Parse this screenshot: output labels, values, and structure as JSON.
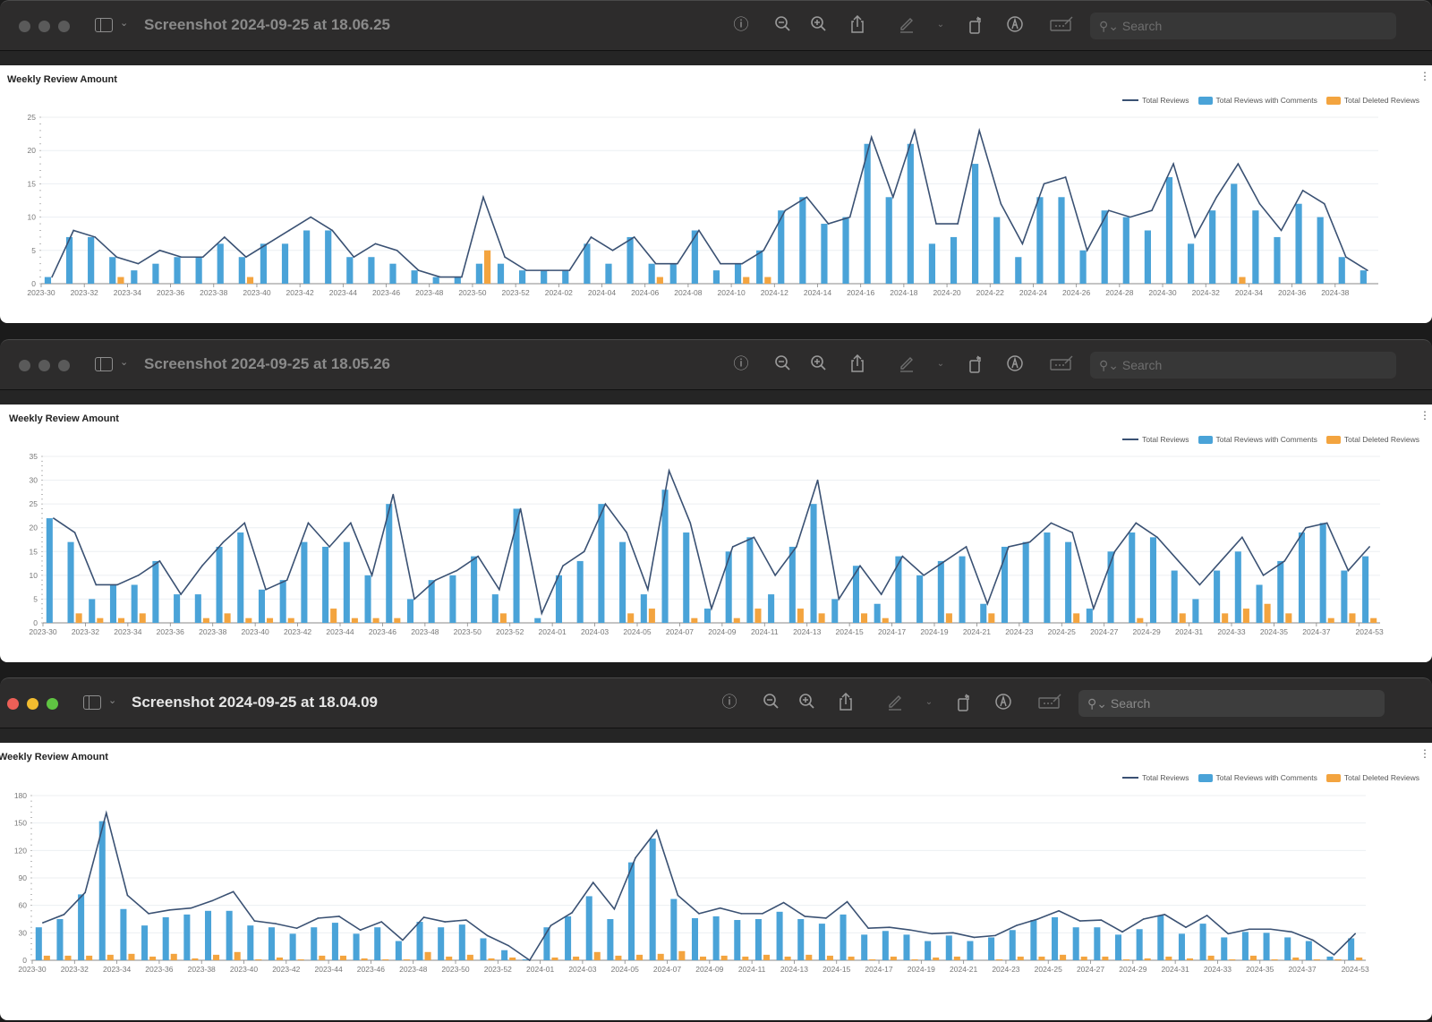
{
  "windows": [
    {
      "title": "Screenshot 2024-09-25 at 18.06.25",
      "active": false,
      "search_placeholder": "Search",
      "toolbar": [
        "info-icon",
        "zoom-out-icon",
        "zoom-in-icon",
        "share-icon",
        "markup-pen-icon",
        "chevron-down-icon",
        "rotate-icon",
        "annotate-icon",
        "signature-icon"
      ]
    },
    {
      "title": "Screenshot 2024-09-25 at 18.05.26",
      "active": false,
      "search_placeholder": "Search",
      "toolbar": [
        "info-icon",
        "zoom-out-icon",
        "zoom-in-icon",
        "share-icon",
        "markup-pen-icon",
        "chevron-down-icon",
        "rotate-icon",
        "annotate-icon",
        "signature-icon"
      ]
    },
    {
      "title": "Screenshot 2024-09-25 at 18.04.09",
      "active": true,
      "search_placeholder": "Search",
      "toolbar": [
        "info-icon",
        "zoom-out-icon",
        "zoom-in-icon",
        "share-icon",
        "markup-pen-icon",
        "chevron-down-icon",
        "rotate-icon",
        "annotate-icon",
        "signature-icon"
      ]
    }
  ],
  "legend": {
    "total": "Total Reviews",
    "comments": "Total Reviews with Comments",
    "deleted": "Total Deleted Reviews"
  },
  "colors": {
    "total_line": "#3a5173",
    "comments_bar": "#4aa3d8",
    "deleted_bar": "#f3a43f"
  },
  "chart_data": [
    {
      "type": "bar",
      "title": "Weekly Review Amount",
      "ylim": [
        0,
        25
      ],
      "yticks": [
        0,
        5,
        10,
        15,
        20,
        25
      ],
      "legend_position": "top-right",
      "grid": true,
      "tick_labels": [
        "2023-30",
        "2023-32",
        "2023-34",
        "2023-36",
        "2023-38",
        "2023-40",
        "2023-42",
        "2023-44",
        "2023-46",
        "2023-48",
        "2023-50",
        "2023-52",
        "2024-02",
        "2024-04",
        "2024-06",
        "2024-08",
        "2024-10",
        "2024-12",
        "2024-14",
        "2024-16",
        "2024-18",
        "2024-20",
        "2024-22",
        "2024-24",
        "2024-26",
        "2024-28",
        "2024-30",
        "2024-32",
        "2024-34",
        "2024-36",
        "2024-38"
      ],
      "series": [
        {
          "name": "Total Reviews",
          "kind": "line",
          "values": [
            1,
            8,
            7,
            4,
            3,
            5,
            4,
            4,
            7,
            4,
            6,
            8,
            10,
            8,
            4,
            6,
            5,
            2,
            1,
            1,
            13,
            4,
            2,
            2,
            2,
            7,
            5,
            7,
            3,
            3,
            8,
            3,
            3,
            5,
            11,
            13,
            9,
            10,
            22,
            13,
            23,
            9,
            9,
            23,
            12,
            6,
            15,
            16,
            5,
            11,
            10,
            11,
            18,
            7,
            13,
            18,
            12,
            8,
            14,
            12,
            4,
            2
          ]
        },
        {
          "name": "Total Reviews with Comments",
          "kind": "bar",
          "values": [
            1,
            7,
            7,
            4,
            2,
            3,
            4,
            4,
            6,
            4,
            6,
            6,
            8,
            8,
            4,
            4,
            3,
            2,
            1,
            1,
            3,
            3,
            2,
            2,
            2,
            6,
            3,
            7,
            3,
            3,
            8,
            2,
            3,
            5,
            11,
            13,
            9,
            10,
            21,
            13,
            21,
            6,
            7,
            18,
            10,
            4,
            13,
            13,
            5,
            11,
            10,
            8,
            16,
            6,
            11,
            15,
            11,
            7,
            12,
            10,
            4,
            2
          ]
        },
        {
          "name": "Total Deleted Reviews",
          "kind": "bar",
          "values": [
            0,
            0,
            0,
            1,
            0,
            0,
            0,
            0,
            0,
            1,
            0,
            0,
            0,
            0,
            0,
            0,
            0,
            0,
            0,
            0,
            5,
            0,
            0,
            0,
            0,
            0,
            0,
            0,
            1,
            0,
            0,
            0,
            1,
            1,
            0,
            0,
            0,
            0,
            0,
            0,
            0,
            0,
            0,
            0,
            0,
            0,
            0,
            0,
            0,
            0,
            0,
            0,
            0,
            0,
            0,
            1,
            0,
            0,
            0,
            0,
            0,
            0
          ]
        }
      ]
    },
    {
      "type": "bar",
      "title": "Weekly Review Amount",
      "ylim": [
        0,
        35
      ],
      "yticks": [
        0,
        5,
        10,
        15,
        20,
        25,
        30,
        35
      ],
      "legend_position": "top-right",
      "grid": true,
      "tick_labels": [
        "2023-30",
        "2023-32",
        "2023-34",
        "2023-36",
        "2023-38",
        "2023-40",
        "2023-42",
        "2023-44",
        "2023-46",
        "2023-48",
        "2023-50",
        "2023-52",
        "2024-01",
        "2024-03",
        "2024-05",
        "2024-07",
        "2024-09",
        "2024-11",
        "2024-13",
        "2024-15",
        "2024-17",
        "2024-19",
        "2024-21",
        "2024-23",
        "2024-25",
        "2024-27",
        "2024-29",
        "2024-31",
        "2024-33",
        "2024-35",
        "2024-37",
        "2024-53"
      ],
      "series": [
        {
          "name": "Total Reviews",
          "kind": "line",
          "values": [
            22,
            19,
            8,
            8,
            10,
            13,
            6,
            12,
            17,
            21,
            7,
            9,
            21,
            16,
            21,
            10,
            27,
            5,
            9,
            11,
            14,
            7,
            24,
            2,
            12,
            15,
            25,
            19,
            7,
            32,
            21,
            3,
            16,
            18,
            10,
            16,
            30,
            5,
            12,
            6,
            14,
            10,
            13,
            16,
            4,
            16,
            17,
            21,
            19,
            3,
            15,
            21,
            18,
            13,
            8,
            13,
            18,
            10,
            13,
            20,
            21,
            11,
            16
          ]
        },
        {
          "name": "Total Reviews with Comments",
          "kind": "bar",
          "values": [
            22,
            17,
            5,
            8,
            8,
            13,
            6,
            6,
            16,
            19,
            7,
            9,
            17,
            16,
            17,
            10,
            25,
            5,
            9,
            10,
            14,
            6,
            24,
            1,
            10,
            13,
            25,
            17,
            6,
            28,
            19,
            3,
            15,
            18,
            6,
            16,
            25,
            5,
            12,
            4,
            14,
            10,
            13,
            14,
            4,
            16,
            17,
            19,
            17,
            3,
            15,
            19,
            18,
            11,
            5,
            11,
            15,
            8,
            13,
            19,
            21,
            11,
            14
          ]
        },
        {
          "name": "Total Deleted Reviews",
          "kind": "bar",
          "values": [
            0,
            2,
            1,
            1,
            2,
            0,
            0,
            1,
            2,
            1,
            1,
            1,
            0,
            3,
            1,
            1,
            1,
            0,
            0,
            0,
            0,
            2,
            0,
            0,
            0,
            0,
            0,
            2,
            3,
            0,
            1,
            0,
            1,
            3,
            0,
            3,
            2,
            0,
            2,
            1,
            0,
            0,
            2,
            0,
            2,
            0,
            0,
            0,
            2,
            0,
            0,
            1,
            0,
            2,
            0,
            2,
            3,
            4,
            2,
            0,
            1,
            2,
            1
          ]
        }
      ]
    },
    {
      "type": "bar",
      "title": "Weekly Review Amount",
      "ylim": [
        0,
        180
      ],
      "yticks": [
        0,
        30,
        60,
        90,
        120,
        150,
        180
      ],
      "legend_position": "top-right",
      "grid": true,
      "tick_labels": [
        "2023-30",
        "2023-32",
        "2023-34",
        "2023-36",
        "2023-38",
        "2023-40",
        "2023-42",
        "2023-44",
        "2023-46",
        "2023-48",
        "2023-50",
        "2023-52",
        "2024-01",
        "2024-03",
        "2024-05",
        "2024-07",
        "2024-09",
        "2024-11",
        "2024-13",
        "2024-15",
        "2024-17",
        "2024-19",
        "2024-21",
        "2024-23",
        "2024-25",
        "2024-27",
        "2024-29",
        "2024-31",
        "2024-33",
        "2024-35",
        "2024-37",
        "2024-53"
      ],
      "series": [
        {
          "name": "Total Reviews",
          "kind": "line",
          "values": [
            41,
            50,
            74,
            161,
            71,
            51,
            55,
            57,
            65,
            75,
            43,
            40,
            35,
            46,
            48,
            33,
            42,
            22,
            47,
            42,
            44,
            27,
            16,
            0,
            38,
            52,
            85,
            56,
            112,
            142,
            71,
            51,
            57,
            51,
            51,
            63,
            48,
            46,
            64,
            35,
            36,
            33,
            29,
            30,
            25,
            27,
            38,
            45,
            54,
            43,
            44,
            31,
            45,
            50,
            36,
            49,
            29,
            34,
            34,
            31,
            22,
            6,
            29
          ]
        },
        {
          "name": "Total Reviews with Comments",
          "kind": "bar",
          "values": [
            36,
            45,
            72,
            152,
            56,
            38,
            47,
            50,
            54,
            54,
            38,
            36,
            29,
            36,
            41,
            29,
            36,
            21,
            42,
            36,
            39,
            24,
            11,
            1,
            36,
            48,
            70,
            45,
            107,
            133,
            67,
            46,
            48,
            44,
            45,
            53,
            45,
            40,
            50,
            28,
            32,
            28,
            21,
            27,
            21,
            25,
            33,
            44,
            47,
            36,
            36,
            28,
            34,
            49,
            29,
            40,
            25,
            31,
            30,
            25,
            21,
            4,
            24
          ]
        },
        {
          "name": "Total Deleted Reviews",
          "kind": "bar",
          "values": [
            5,
            5,
            5,
            6,
            7,
            4,
            7,
            2,
            6,
            9,
            1,
            3,
            1,
            5,
            5,
            2,
            1,
            1,
            9,
            4,
            6,
            2,
            3,
            0,
            3,
            4,
            9,
            5,
            6,
            7,
            10,
            4,
            5,
            4,
            6,
            4,
            6,
            5,
            4,
            1,
            4,
            1,
            3,
            4,
            0,
            1,
            4,
            4,
            6,
            4,
            4,
            1,
            2,
            4,
            2,
            5,
            1,
            5,
            1,
            3,
            1,
            1,
            3
          ]
        }
      ]
    }
  ]
}
